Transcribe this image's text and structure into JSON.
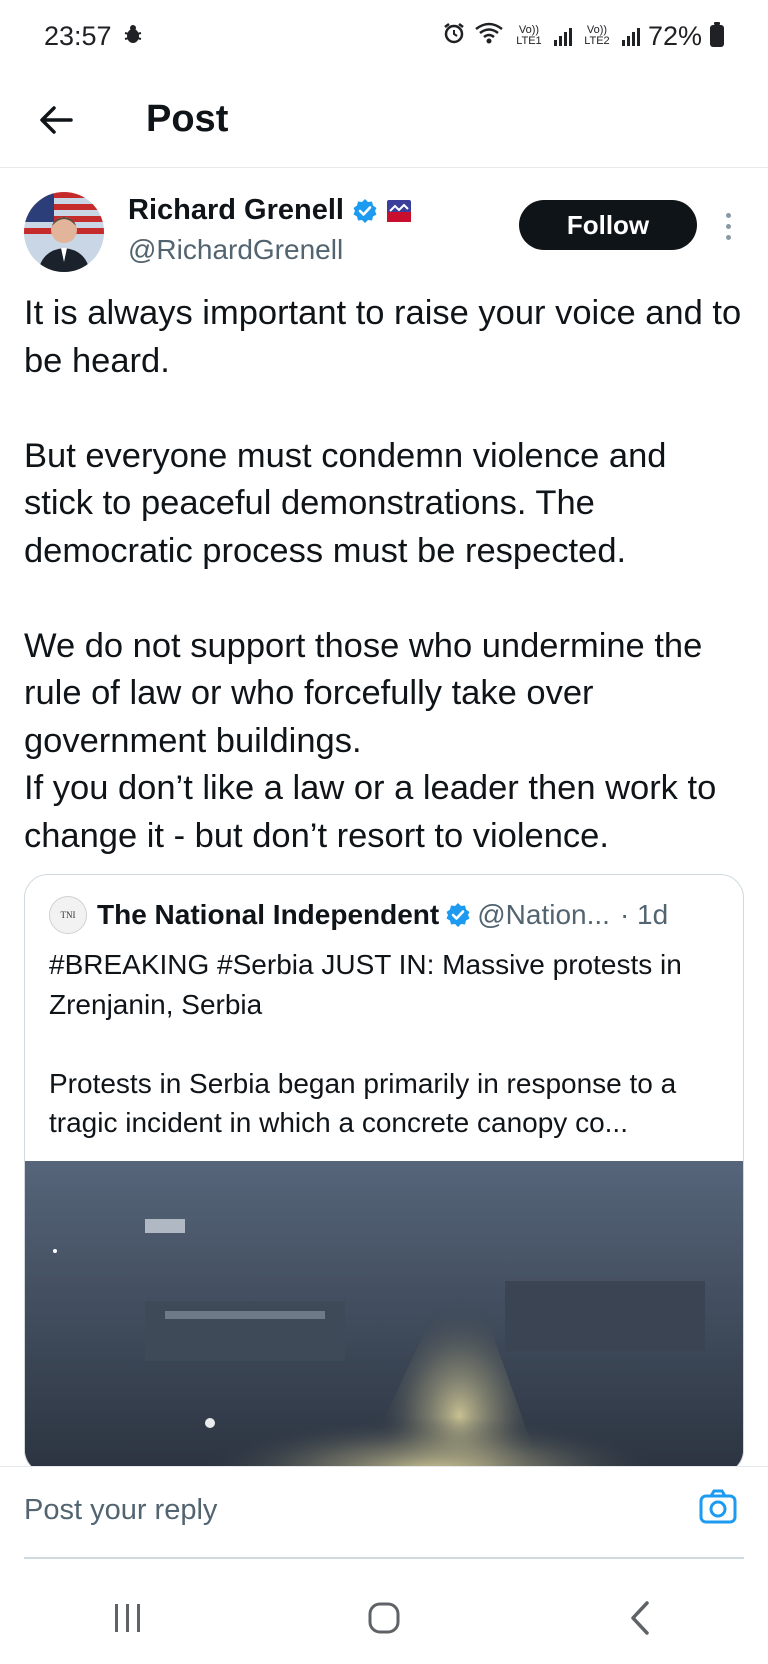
{
  "status_bar": {
    "time": "23:57",
    "battery": "72%",
    "sim1_tag": "Vo)) LTE1",
    "sim2_tag": "Vo)) LTE2"
  },
  "header": {
    "title": "Post"
  },
  "author": {
    "name": "Richard Grenell",
    "handle": "@RichardGrenell",
    "follow_label": "Follow"
  },
  "post": {
    "paragraph1": "It is always important to raise your voice and to be heard.",
    "paragraph2": "But everyone must condemn violence and stick to peaceful demonstrations. The democratic process must be respected.",
    "paragraph3": "We do not support those who undermine the rule of law or who forcefully take over government buildings.",
    "paragraph4": "If you don’t like a law or a leader then work to change it - but don’t resort to violence."
  },
  "quote": {
    "avatar_text": "TNI",
    "name": "The National Independent",
    "handle": "@Nation...",
    "time": "· 1d",
    "text1": "#BREAKING #Serbia JUST IN: Massive protests in Zrenjanin, Serbia",
    "text2": "Protests in Serbia began primarily in response to a tragic incident in which a concrete canopy co..."
  },
  "reply": {
    "placeholder": "Post your reply"
  },
  "colors": {
    "text_primary": "#0f1419",
    "text_secondary": "#536471",
    "verified_blue": "#1d9bf0",
    "follow_bg": "#0f1419"
  },
  "icons": {
    "back": "arrow-left-icon",
    "verified": "verified-badge-icon",
    "affiliate": "affiliate-badge-icon",
    "more": "more-vertical-icon",
    "camera": "camera-icon",
    "nav_recents": "recents-icon",
    "nav_home": "home-icon",
    "nav_back": "nav-back-icon"
  }
}
